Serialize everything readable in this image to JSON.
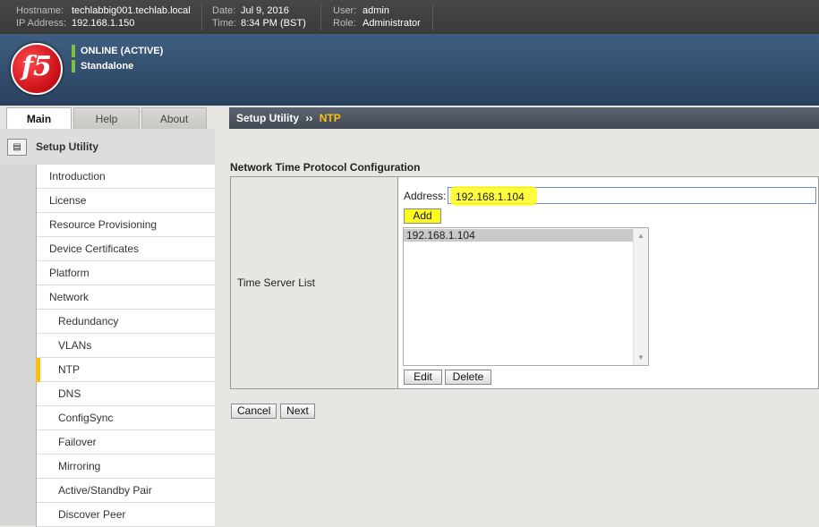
{
  "header": {
    "hostname_label": "Hostname:",
    "hostname": "techlabbig001.techlab.local",
    "ip_label": "IP Address:",
    "ip": "192.168.1.150",
    "date_label": "Date:",
    "date": "Jul 9, 2016",
    "time_label": "Time:",
    "time": "8:34 PM (BST)",
    "user_label": "User:",
    "user": "admin",
    "role_label": "Role:",
    "role": "Administrator"
  },
  "banner": {
    "logo_text": "f5",
    "status_online": "ONLINE (ACTIVE)",
    "status_mode": "Standalone",
    "status_color": "#7dc242"
  },
  "tabs": [
    {
      "label": "Main"
    },
    {
      "label": "Help"
    },
    {
      "label": "About"
    }
  ],
  "breadcrumb": {
    "parent": "Setup Utility",
    "separator": "››",
    "current": "NTP"
  },
  "sidebar": {
    "heading": "Setup Utility",
    "items": [
      {
        "label": "Introduction"
      },
      {
        "label": "License"
      },
      {
        "label": "Resource Provisioning"
      },
      {
        "label": "Device Certificates"
      },
      {
        "label": "Platform"
      },
      {
        "label": "Network"
      },
      {
        "label": "Redundancy"
      },
      {
        "label": "VLANs"
      },
      {
        "label": "NTP"
      },
      {
        "label": "DNS"
      },
      {
        "label": "ConfigSync"
      },
      {
        "label": "Failover"
      },
      {
        "label": "Mirroring"
      },
      {
        "label": "Active/Standby Pair"
      },
      {
        "label": "Discover Peer"
      }
    ]
  },
  "main": {
    "section_title": "Network Time Protocol Configuration",
    "row_label": "Time Server List",
    "address_label": "Address:",
    "address_value": "192.168.1.104",
    "add_button": "Add",
    "servers": [
      "192.168.1.104"
    ],
    "edit_button": "Edit",
    "delete_button": "Delete",
    "cancel_button": "Cancel",
    "next_button": "Next"
  },
  "colors": {
    "accent": "#f8c010",
    "highlight": "#fffb1e",
    "banner": "#3f5e80"
  }
}
